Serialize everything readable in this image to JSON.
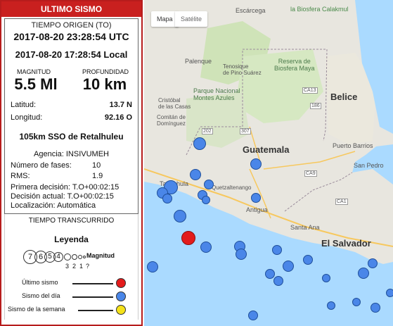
{
  "panel": {
    "header": "ULTIMO SISMO",
    "origin_label": "TIEMPO ORIGEN (TO)",
    "utc_time": "2017-08-20 23:28:54 UTC",
    "local_time": "2017-08-20 17:28:54 Local",
    "magnitude_label": "MAGNITUD",
    "depth_label": "PROFUNDIDAD",
    "magnitude": "5.5 Ml",
    "depth": "10 km",
    "lat_label": "Latitud:",
    "lat": "13.7 N",
    "lon_label": "Longitud:",
    "lon": "92.16 O",
    "location": "105km SSO de Retalhuleu",
    "agency": "Agencia: INSIVUMEH",
    "phases_label": "Número de fases:",
    "phases": "10",
    "rms_label": "RMS:",
    "rms": "1.9",
    "first_decision": "Primera decisión: T.O+00:02:15",
    "current_decision": "Decisión actual: T.O+00:02:15",
    "localization": "Localización: Automática",
    "elapsed_label": "TIEMPO TRANSCURRIDO",
    "legend_title": "Leyenda",
    "magnitude_circles": [
      "7",
      "6",
      "5",
      "4"
    ],
    "small_labels": [
      "3",
      "2",
      "1",
      "?"
    ],
    "magnitud_word": "Magnitud",
    "legend_items": [
      {
        "label": "Último sismo",
        "color": "#e31b1b"
      },
      {
        "label": "Sismo del día",
        "color": "#4a86e8"
      },
      {
        "label": "Sismo de la semana",
        "color": "#f5e21a"
      }
    ]
  },
  "map": {
    "tabs": [
      "Mapa",
      "Satélite"
    ],
    "labels": {
      "guatemala": "Guatemala",
      "belice": "Belice",
      "el_salvador": "El Salvador",
      "reserva": "Reserva de\nBiosfera Maya",
      "la_biosfera": "la Biosfera\nCalakmul",
      "parque": "Parque Nacional\nMontes Azules",
      "tapachula": "Tapachula",
      "antigua": "Antigua",
      "puerto_barrios": "Puerto Barrios",
      "san_pedro": "San Pedro",
      "santa_ana": "Santa Ana",
      "palenque": "Palenque",
      "tenosique": "Tenosique\nde Pino Suárez",
      "escarcega": "Escárcega",
      "cristobal": "Cristóbal\nde las Casas",
      "comitan": "Comitán de\nDomínguez",
      "quetzaltenango": "Quetzaltenango",
      "ca13": "CA13",
      "ca9": "CA9",
      "ca1": "CA1",
      "r307": "307",
      "r202": "202",
      "r307b": "307",
      "r186": "186"
    },
    "quake_colors": {
      "day": "#4a86e8",
      "last": "#e31b1b"
    },
    "last_quake_mag": 5.5
  }
}
